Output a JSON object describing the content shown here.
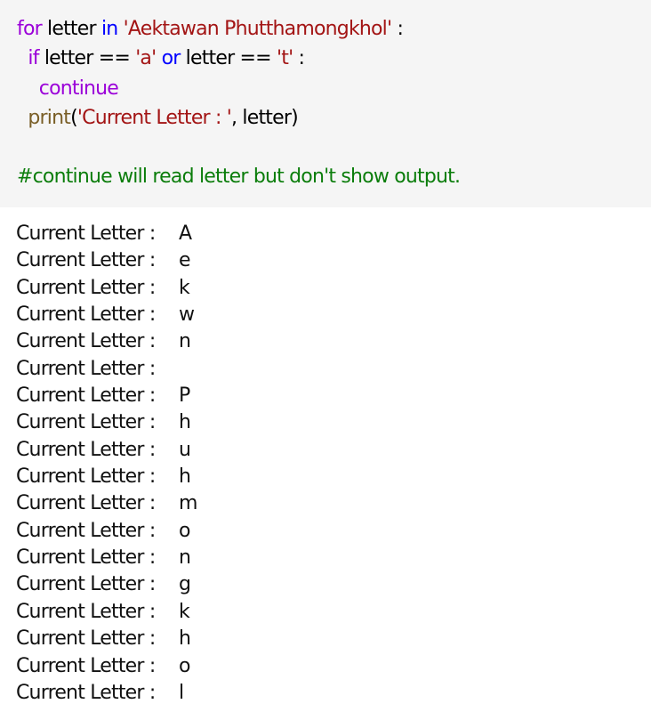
{
  "code": {
    "line1": {
      "kw_for": "for",
      "var1": " letter ",
      "kw_in": "in",
      "sp": " ",
      "string": "'Aektawan Phutthamongkhol'",
      "colon": " :"
    },
    "line2": {
      "indent": "  ",
      "kw_if": "if",
      "cond1": " letter == ",
      "str_a": "'a'",
      "sp": " ",
      "kw_or": "or",
      "cond2": " letter == ",
      "str_t": "'t'",
      "colon": " :"
    },
    "line3": {
      "indent": "    ",
      "kw_continue": "continue"
    },
    "line4": {
      "indent": "  ",
      "fn_print": "print",
      "open": "(",
      "string": "'Current Letter : '",
      "rest": ", letter)"
    },
    "comment": "#continue will read letter but don't show output."
  },
  "output": {
    "lines": [
      {
        "label": "Current Letter : ",
        "value": "A"
      },
      {
        "label": "Current Letter : ",
        "value": "e"
      },
      {
        "label": "Current Letter : ",
        "value": "k"
      },
      {
        "label": "Current Letter : ",
        "value": "w"
      },
      {
        "label": "Current Letter : ",
        "value": "n"
      },
      {
        "label": "Current Letter : ",
        "value": ""
      },
      {
        "label": "Current Letter : ",
        "value": "P"
      },
      {
        "label": "Current Letter : ",
        "value": "h"
      },
      {
        "label": "Current Letter : ",
        "value": "u"
      },
      {
        "label": "Current Letter : ",
        "value": "h"
      },
      {
        "label": "Current Letter : ",
        "value": "m"
      },
      {
        "label": "Current Letter : ",
        "value": "o"
      },
      {
        "label": "Current Letter : ",
        "value": "n"
      },
      {
        "label": "Current Letter : ",
        "value": "g"
      },
      {
        "label": "Current Letter : ",
        "value": "k"
      },
      {
        "label": "Current Letter : ",
        "value": "h"
      },
      {
        "label": "Current Letter : ",
        "value": "o"
      },
      {
        "label": "Current Letter : ",
        "value": "l"
      }
    ]
  },
  "colors": {
    "code_background": "#f5f5f5",
    "keyword_purple": "#9b00d9",
    "keyword_blue": "#0000ff",
    "string": "#a31515",
    "function": "#795e26",
    "comment": "#0b7d0b"
  }
}
